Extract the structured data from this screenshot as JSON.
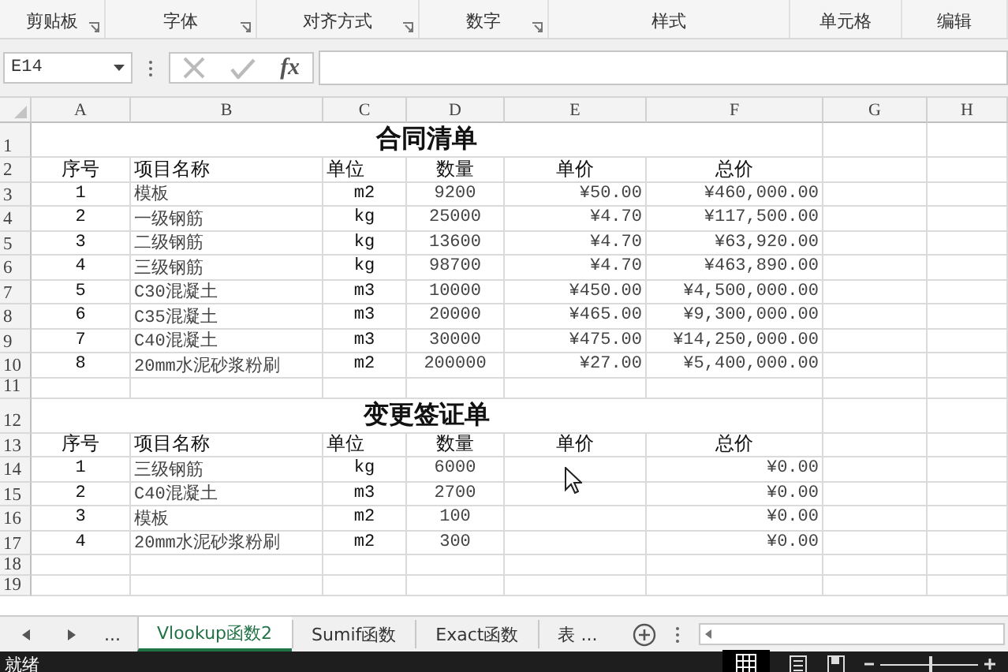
{
  "ribbon": {
    "groups": [
      {
        "label": "剪贴板",
        "launcher": true
      },
      {
        "label": "字体",
        "launcher": true
      },
      {
        "label": "对齐方式",
        "launcher": true
      },
      {
        "label": "数字",
        "launcher": true
      },
      {
        "label": "样式",
        "launcher": false
      },
      {
        "label": "单元格",
        "launcher": false
      },
      {
        "label": "编辑",
        "launcher": false
      }
    ]
  },
  "formula_bar": {
    "name_box": "E14",
    "fx": "fx"
  },
  "sheet": {
    "columns": [
      "A",
      "B",
      "C",
      "D",
      "E",
      "F",
      "G",
      "H"
    ],
    "rows": [
      {
        "num": "1",
        "kind": "title",
        "title": "合同清单"
      },
      {
        "num": "2",
        "kind": "header",
        "cells": {
          "A": "序号",
          "B": "项目名称",
          "C": "单位",
          "D": "数量",
          "E": "单价",
          "F": "总价"
        }
      },
      {
        "num": "3",
        "kind": "data",
        "cells": {
          "A": "1",
          "B": "模板",
          "C": "m2",
          "D": "9200",
          "E": "¥50.00",
          "F": "¥460,000.00"
        }
      },
      {
        "num": "4",
        "kind": "data",
        "cells": {
          "A": "2",
          "B": "一级钢筋",
          "C": "kg",
          "D": "25000",
          "E": "¥4.70",
          "F": "¥117,500.00"
        }
      },
      {
        "num": "5",
        "kind": "data",
        "cells": {
          "A": "3",
          "B": "二级钢筋",
          "C": "kg",
          "D": "13600",
          "E": "¥4.70",
          "F": "¥63,920.00"
        }
      },
      {
        "num": "6",
        "kind": "data",
        "cells": {
          "A": "4",
          "B": "三级钢筋",
          "C": "kg",
          "D": "98700",
          "E": "¥4.70",
          "F": "¥463,890.00"
        }
      },
      {
        "num": "7",
        "kind": "data",
        "cells": {
          "A": "5",
          "B": "C30混凝土",
          "C": "m3",
          "D": "10000",
          "E": "¥450.00",
          "F": "¥4,500,000.00"
        }
      },
      {
        "num": "8",
        "kind": "data",
        "cells": {
          "A": "6",
          "B": "C35混凝土",
          "C": "m3",
          "D": "20000",
          "E": "¥465.00",
          "F": "¥9,300,000.00"
        }
      },
      {
        "num": "9",
        "kind": "data",
        "cells": {
          "A": "7",
          "B": "C40混凝土",
          "C": "m3",
          "D": "30000",
          "E": "¥475.00",
          "F": "¥14,250,000.00"
        }
      },
      {
        "num": "10",
        "kind": "data",
        "cells": {
          "A": "8",
          "B": "20mm水泥砂浆粉刷",
          "C": "m2",
          "D": "200000",
          "E": "¥27.00",
          "F": "¥5,400,000.00"
        }
      },
      {
        "num": "11",
        "kind": "empty"
      },
      {
        "num": "12",
        "kind": "title",
        "title": "变更签证单"
      },
      {
        "num": "13",
        "kind": "header",
        "cells": {
          "A": "序号",
          "B": "项目名称",
          "C": "单位",
          "D": "数量",
          "E": "单价",
          "F": "总价"
        }
      },
      {
        "num": "14",
        "kind": "data",
        "cells": {
          "A": "1",
          "B": "三级钢筋",
          "C": "kg",
          "D": "6000",
          "F": "¥0.00"
        }
      },
      {
        "num": "15",
        "kind": "data",
        "cells": {
          "A": "2",
          "B": "C40混凝土",
          "C": "m3",
          "D": "2700",
          "F": "¥0.00"
        }
      },
      {
        "num": "16",
        "kind": "data",
        "cells": {
          "A": "3",
          "B": "模板",
          "C": "m2",
          "D": "100",
          "F": "¥0.00"
        }
      },
      {
        "num": "17",
        "kind": "data",
        "cells": {
          "A": "4",
          "B": "20mm水泥砂浆粉刷",
          "C": "m2",
          "D": "300",
          "F": "¥0.00"
        }
      },
      {
        "num": "18",
        "kind": "empty"
      },
      {
        "num": "19",
        "kind": "empty"
      }
    ]
  },
  "sheet_tabs": {
    "more_left": "...",
    "tabs": [
      {
        "label": "Vlookup函数2",
        "selected": true
      },
      {
        "label": "Sumif函数",
        "selected": false
      },
      {
        "label": "Exact函数",
        "selected": false
      },
      {
        "label": "表 ...",
        "selected": false
      }
    ]
  },
  "status_bar": {
    "text": "就绪",
    "zoom": {
      "level": 0.52
    }
  }
}
